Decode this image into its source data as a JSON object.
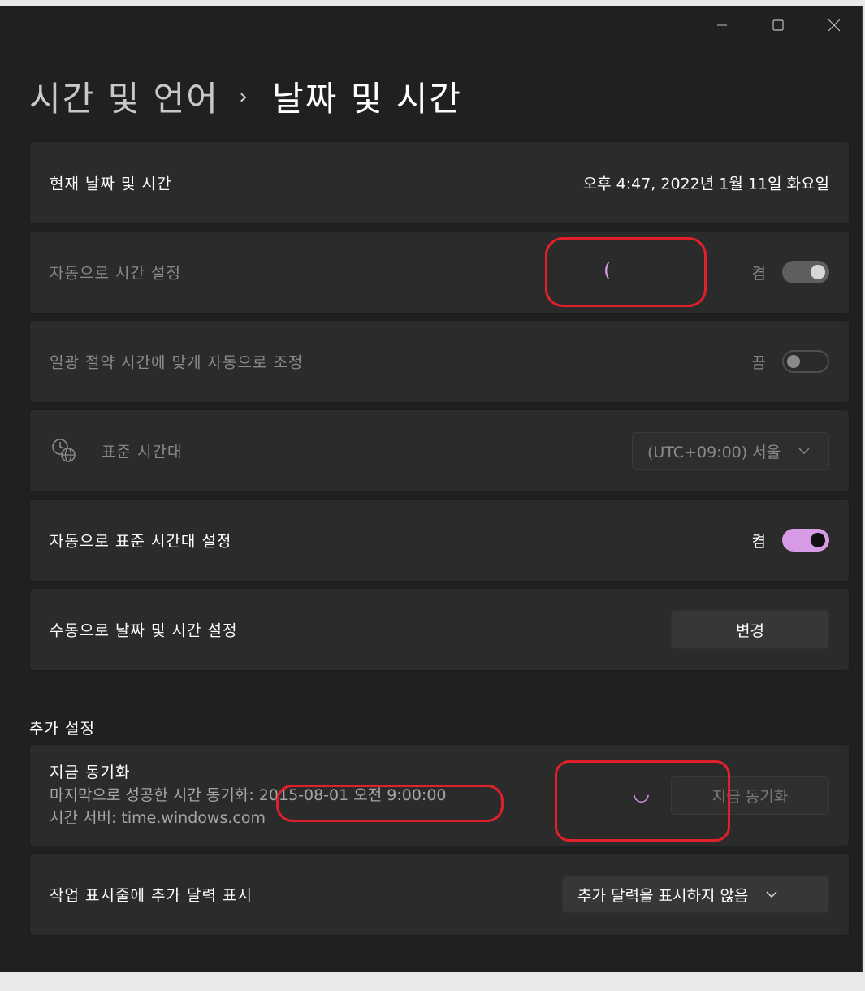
{
  "breadcrumb": {
    "parent": "시간 및 언어",
    "separator": "›",
    "current": "날짜 및 시간"
  },
  "current_datetime": {
    "label": "현재 날짜 및 시간",
    "value": "오후 4:47, 2022년 1월 11일 화요일"
  },
  "auto_time": {
    "label": "자동으로 시간 설정",
    "state": "켬",
    "on": true,
    "spinner": "("
  },
  "dst": {
    "label": "일광 절약 시간에 맞게 자동으로 조정",
    "state": "끔",
    "on": false
  },
  "timezone": {
    "label": "표준 시간대",
    "icon": "clock-globe-icon",
    "selected": "(UTC+09:00) 서울"
  },
  "auto_timezone": {
    "label": "자동으로 표준 시간대 설정",
    "state": "켬",
    "on": true
  },
  "manual": {
    "label": "수동으로 날짜 및 시간 설정",
    "button": "변경"
  },
  "additional": {
    "title": "추가 설정"
  },
  "sync": {
    "title": "지금 동기화",
    "last_success": "마지막으로 성공한 시간 동기화: 2015-08-01 오전 9:00:00",
    "server": "시간 서버: time.windows.com",
    "button": "지금 동기화",
    "spinner": "◡"
  },
  "calendar": {
    "label": "작업 표시줄에 추가 달력 표시",
    "selected": "추가 달력을 표시하지 않음"
  },
  "colors": {
    "accent": "#d79be6",
    "annotation": "#e0202a",
    "background": "#202020",
    "card": "#2b2b2b"
  }
}
